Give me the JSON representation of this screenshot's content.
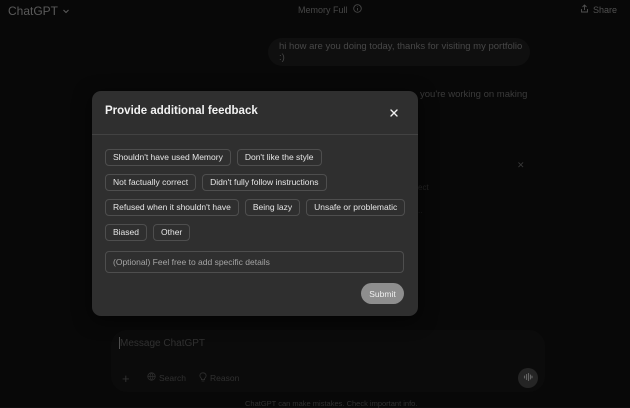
{
  "header": {
    "app_title": "ChatGPT",
    "center_title": "Memory Full",
    "share_label": "Share"
  },
  "conversation": {
    "user_message": "hi how are you doing today, thanks for visiting my portfolio :)",
    "assistant_partial": "you're working on making",
    "background_fragment_1": "ect",
    "background_fragment_2": ".."
  },
  "composer": {
    "placeholder": "Message ChatGPT",
    "search_label": "Search",
    "reason_label": "Reason"
  },
  "footer": {
    "note": "ChatGPT can make mistakes. Check important info."
  },
  "modal": {
    "title": "Provide additional feedback",
    "chips": [
      "Shouldn't have used Memory",
      "Don't like the style",
      "Not factually correct",
      "Didn't fully follow instructions",
      "Refused when it shouldn't have",
      "Being lazy",
      "Unsafe or problematic",
      "Biased",
      "Other"
    ],
    "details_placeholder": "(Optional) Feel free to add specific details",
    "submit_label": "Submit"
  }
}
